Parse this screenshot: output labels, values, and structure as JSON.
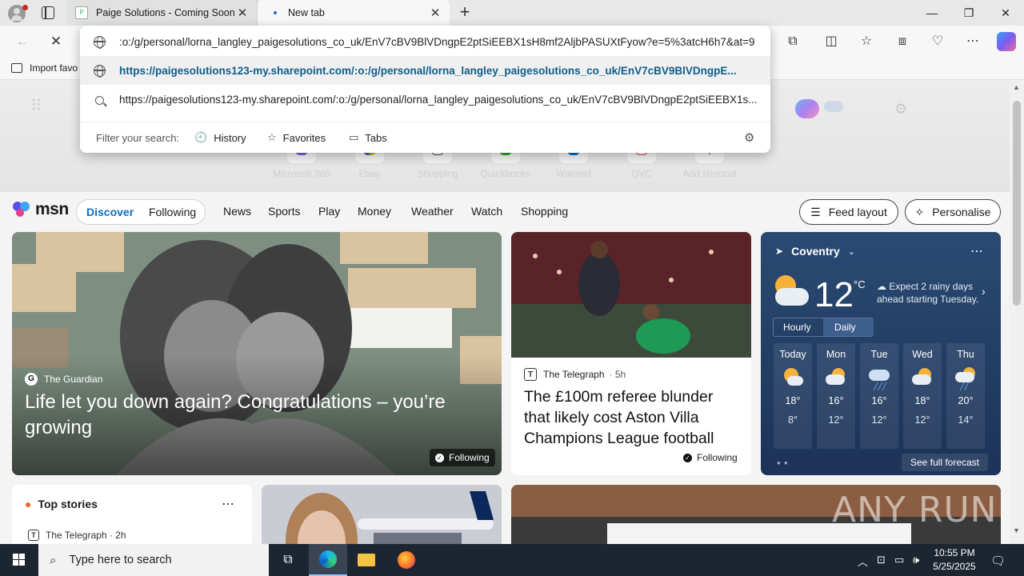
{
  "browser": {
    "tabs": [
      {
        "label": "Paige Solutions - Coming Soon"
      },
      {
        "label": "New tab"
      }
    ],
    "address_bar": {
      "value": ":o:/g/personal/lorna_langley_paigesolutions_co_uk/EnV7cBV9BlVDngpE2ptSiEEBX1sH8mf2AljbPASUXtFyow?e=5%3atcH6h7&at=9"
    },
    "favorites_bar": {
      "import_label": "Import favo"
    },
    "omnibox": {
      "suggestion_url": "https://paigesolutions123-my.sharepoint.com/:o:/g/personal/lorna_langley_paigesolutions_co_uk/EnV7cBV9BlVDngpE...",
      "search_suggestion": "https://paigesolutions123-my.sharepoint.com/:o:/g/personal/lorna_langley_paigesolutions_co_uk/EnV7cBV9BlVDngpE2ptSiEEBX1s...",
      "filter_label": "Filter your search:",
      "filters": [
        "History",
        "Favorites",
        "Tabs"
      ]
    }
  },
  "shortcuts": [
    "Microsoft 365",
    "Ebay",
    "Shopping",
    "Quickbooks",
    "Walmart",
    "QVC",
    "Add shortcut"
  ],
  "msn": {
    "logo": "msn",
    "pill": {
      "discover": "Discover",
      "following": "Following"
    },
    "nav": [
      "News",
      "Sports",
      "Play",
      "Money",
      "Weather",
      "Watch",
      "Shopping"
    ],
    "feed_layout": "Feed layout",
    "personalise": "Personalise"
  },
  "hero": {
    "source": "The Guardian",
    "title": "Life let you down again? Congratulations – you’re growing",
    "badge": "Following"
  },
  "news_card": {
    "source": "The Telegraph",
    "age": "· 5h",
    "title": "The £100m referee blunder that likely cost Aston Villa Champions League football",
    "badge": "Following"
  },
  "weather": {
    "location": "Coventry",
    "temp": "12",
    "unit": "°C",
    "summary": "Expect 2 rainy days ahead starting Tuesday.",
    "toggle": [
      "Hourly",
      "Daily"
    ],
    "days": [
      {
        "name": "Today",
        "hi": "18°",
        "lo": "8°",
        "icon": "partly-sunny"
      },
      {
        "name": "Mon",
        "hi": "16°",
        "lo": "12°",
        "icon": "partly-cloudy"
      },
      {
        "name": "Tue",
        "hi": "16°",
        "lo": "12°",
        "icon": "rain"
      },
      {
        "name": "Wed",
        "hi": "18°",
        "lo": "12°",
        "icon": "partly-cloudy"
      },
      {
        "name": "Thu",
        "hi": "20°",
        "lo": "14°",
        "icon": "rain-sun"
      }
    ],
    "see_forecast": "See full forecast"
  },
  "top_stories": {
    "title": "Top stories",
    "source": "The Telegraph · 2h"
  },
  "watermark": "ANY RUN",
  "taskbar": {
    "search_placeholder": "Type here to search",
    "time": "10:55 PM",
    "date": "5/25/2025"
  }
}
